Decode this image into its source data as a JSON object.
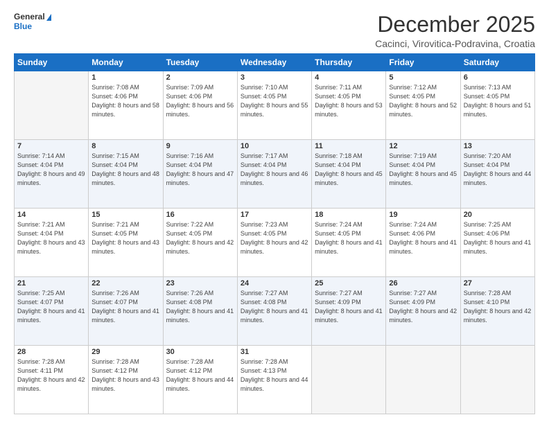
{
  "logo": {
    "line1": "General",
    "line2": "Blue"
  },
  "title": "December 2025",
  "location": "Cacinci, Virovitica-Podravina, Croatia",
  "weekdays": [
    "Sunday",
    "Monday",
    "Tuesday",
    "Wednesday",
    "Thursday",
    "Friday",
    "Saturday"
  ],
  "weeks": [
    [
      {
        "day": "",
        "sunrise": "",
        "sunset": "",
        "daylight": ""
      },
      {
        "day": "1",
        "sunrise": "Sunrise: 7:08 AM",
        "sunset": "Sunset: 4:06 PM",
        "daylight": "Daylight: 8 hours and 58 minutes."
      },
      {
        "day": "2",
        "sunrise": "Sunrise: 7:09 AM",
        "sunset": "Sunset: 4:06 PM",
        "daylight": "Daylight: 8 hours and 56 minutes."
      },
      {
        "day": "3",
        "sunrise": "Sunrise: 7:10 AM",
        "sunset": "Sunset: 4:05 PM",
        "daylight": "Daylight: 8 hours and 55 minutes."
      },
      {
        "day": "4",
        "sunrise": "Sunrise: 7:11 AM",
        "sunset": "Sunset: 4:05 PM",
        "daylight": "Daylight: 8 hours and 53 minutes."
      },
      {
        "day": "5",
        "sunrise": "Sunrise: 7:12 AM",
        "sunset": "Sunset: 4:05 PM",
        "daylight": "Daylight: 8 hours and 52 minutes."
      },
      {
        "day": "6",
        "sunrise": "Sunrise: 7:13 AM",
        "sunset": "Sunset: 4:05 PM",
        "daylight": "Daylight: 8 hours and 51 minutes."
      }
    ],
    [
      {
        "day": "7",
        "sunrise": "Sunrise: 7:14 AM",
        "sunset": "Sunset: 4:04 PM",
        "daylight": "Daylight: 8 hours and 49 minutes."
      },
      {
        "day": "8",
        "sunrise": "Sunrise: 7:15 AM",
        "sunset": "Sunset: 4:04 PM",
        "daylight": "Daylight: 8 hours and 48 minutes."
      },
      {
        "day": "9",
        "sunrise": "Sunrise: 7:16 AM",
        "sunset": "Sunset: 4:04 PM",
        "daylight": "Daylight: 8 hours and 47 minutes."
      },
      {
        "day": "10",
        "sunrise": "Sunrise: 7:17 AM",
        "sunset": "Sunset: 4:04 PM",
        "daylight": "Daylight: 8 hours and 46 minutes."
      },
      {
        "day": "11",
        "sunrise": "Sunrise: 7:18 AM",
        "sunset": "Sunset: 4:04 PM",
        "daylight": "Daylight: 8 hours and 45 minutes."
      },
      {
        "day": "12",
        "sunrise": "Sunrise: 7:19 AM",
        "sunset": "Sunset: 4:04 PM",
        "daylight": "Daylight: 8 hours and 45 minutes."
      },
      {
        "day": "13",
        "sunrise": "Sunrise: 7:20 AM",
        "sunset": "Sunset: 4:04 PM",
        "daylight": "Daylight: 8 hours and 44 minutes."
      }
    ],
    [
      {
        "day": "14",
        "sunrise": "Sunrise: 7:21 AM",
        "sunset": "Sunset: 4:04 PM",
        "daylight": "Daylight: 8 hours and 43 minutes."
      },
      {
        "day": "15",
        "sunrise": "Sunrise: 7:21 AM",
        "sunset": "Sunset: 4:05 PM",
        "daylight": "Daylight: 8 hours and 43 minutes."
      },
      {
        "day": "16",
        "sunrise": "Sunrise: 7:22 AM",
        "sunset": "Sunset: 4:05 PM",
        "daylight": "Daylight: 8 hours and 42 minutes."
      },
      {
        "day": "17",
        "sunrise": "Sunrise: 7:23 AM",
        "sunset": "Sunset: 4:05 PM",
        "daylight": "Daylight: 8 hours and 42 minutes."
      },
      {
        "day": "18",
        "sunrise": "Sunrise: 7:24 AM",
        "sunset": "Sunset: 4:05 PM",
        "daylight": "Daylight: 8 hours and 41 minutes."
      },
      {
        "day": "19",
        "sunrise": "Sunrise: 7:24 AM",
        "sunset": "Sunset: 4:06 PM",
        "daylight": "Daylight: 8 hours and 41 minutes."
      },
      {
        "day": "20",
        "sunrise": "Sunrise: 7:25 AM",
        "sunset": "Sunset: 4:06 PM",
        "daylight": "Daylight: 8 hours and 41 minutes."
      }
    ],
    [
      {
        "day": "21",
        "sunrise": "Sunrise: 7:25 AM",
        "sunset": "Sunset: 4:07 PM",
        "daylight": "Daylight: 8 hours and 41 minutes."
      },
      {
        "day": "22",
        "sunrise": "Sunrise: 7:26 AM",
        "sunset": "Sunset: 4:07 PM",
        "daylight": "Daylight: 8 hours and 41 minutes."
      },
      {
        "day": "23",
        "sunrise": "Sunrise: 7:26 AM",
        "sunset": "Sunset: 4:08 PM",
        "daylight": "Daylight: 8 hours and 41 minutes."
      },
      {
        "day": "24",
        "sunrise": "Sunrise: 7:27 AM",
        "sunset": "Sunset: 4:08 PM",
        "daylight": "Daylight: 8 hours and 41 minutes."
      },
      {
        "day": "25",
        "sunrise": "Sunrise: 7:27 AM",
        "sunset": "Sunset: 4:09 PM",
        "daylight": "Daylight: 8 hours and 41 minutes."
      },
      {
        "day": "26",
        "sunrise": "Sunrise: 7:27 AM",
        "sunset": "Sunset: 4:09 PM",
        "daylight": "Daylight: 8 hours and 42 minutes."
      },
      {
        "day": "27",
        "sunrise": "Sunrise: 7:28 AM",
        "sunset": "Sunset: 4:10 PM",
        "daylight": "Daylight: 8 hours and 42 minutes."
      }
    ],
    [
      {
        "day": "28",
        "sunrise": "Sunrise: 7:28 AM",
        "sunset": "Sunset: 4:11 PM",
        "daylight": "Daylight: 8 hours and 42 minutes."
      },
      {
        "day": "29",
        "sunrise": "Sunrise: 7:28 AM",
        "sunset": "Sunset: 4:12 PM",
        "daylight": "Daylight: 8 hours and 43 minutes."
      },
      {
        "day": "30",
        "sunrise": "Sunrise: 7:28 AM",
        "sunset": "Sunset: 4:12 PM",
        "daylight": "Daylight: 8 hours and 44 minutes."
      },
      {
        "day": "31",
        "sunrise": "Sunrise: 7:28 AM",
        "sunset": "Sunset: 4:13 PM",
        "daylight": "Daylight: 8 hours and 44 minutes."
      },
      {
        "day": "",
        "sunrise": "",
        "sunset": "",
        "daylight": ""
      },
      {
        "day": "",
        "sunrise": "",
        "sunset": "",
        "daylight": ""
      },
      {
        "day": "",
        "sunrise": "",
        "sunset": "",
        "daylight": ""
      }
    ]
  ]
}
